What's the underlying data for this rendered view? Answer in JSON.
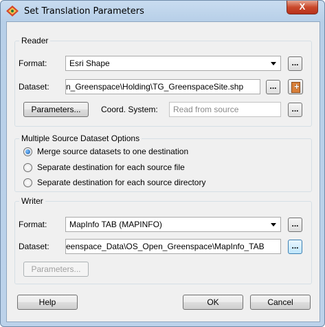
{
  "window": {
    "title": "Set Translation Parameters",
    "close_label": "X"
  },
  "reader": {
    "group_label": "Reader",
    "format_label": "Format:",
    "format_value": "Esri Shape",
    "dataset_label": "Dataset:",
    "dataset_value": "n_Greenspace\\Holding\\TG_GreenspaceSite.shp",
    "parameters_label": "Parameters...",
    "coord_label": "Coord. System:",
    "coord_placeholder": "Read from source",
    "browse_label": "..."
  },
  "multi_source": {
    "group_label": "Multiple Source Dataset Options",
    "options": [
      {
        "label": "Merge source datasets to one destination",
        "checked": true
      },
      {
        "label": "Separate destination for each source file",
        "checked": false
      },
      {
        "label": "Separate destination for each source directory",
        "checked": false
      }
    ]
  },
  "writer": {
    "group_label": "Writer",
    "format_label": "Format:",
    "format_value": "MapInfo TAB (MAPINFO)",
    "dataset_label": "Dataset:",
    "dataset_value": "eenspace_Data\\OS_Open_Greenspace\\MapInfo_TAB",
    "parameters_label": "Parameters...",
    "browse_label": "..."
  },
  "footer": {
    "help_label": "Help",
    "ok_label": "OK",
    "cancel_label": "Cancel"
  },
  "colors": {
    "accent": "#3c7fb1",
    "close": "#c9492c"
  },
  "icons": {
    "app": "fme-workbench-icon",
    "add_dataset": "add-dataset-icon"
  }
}
